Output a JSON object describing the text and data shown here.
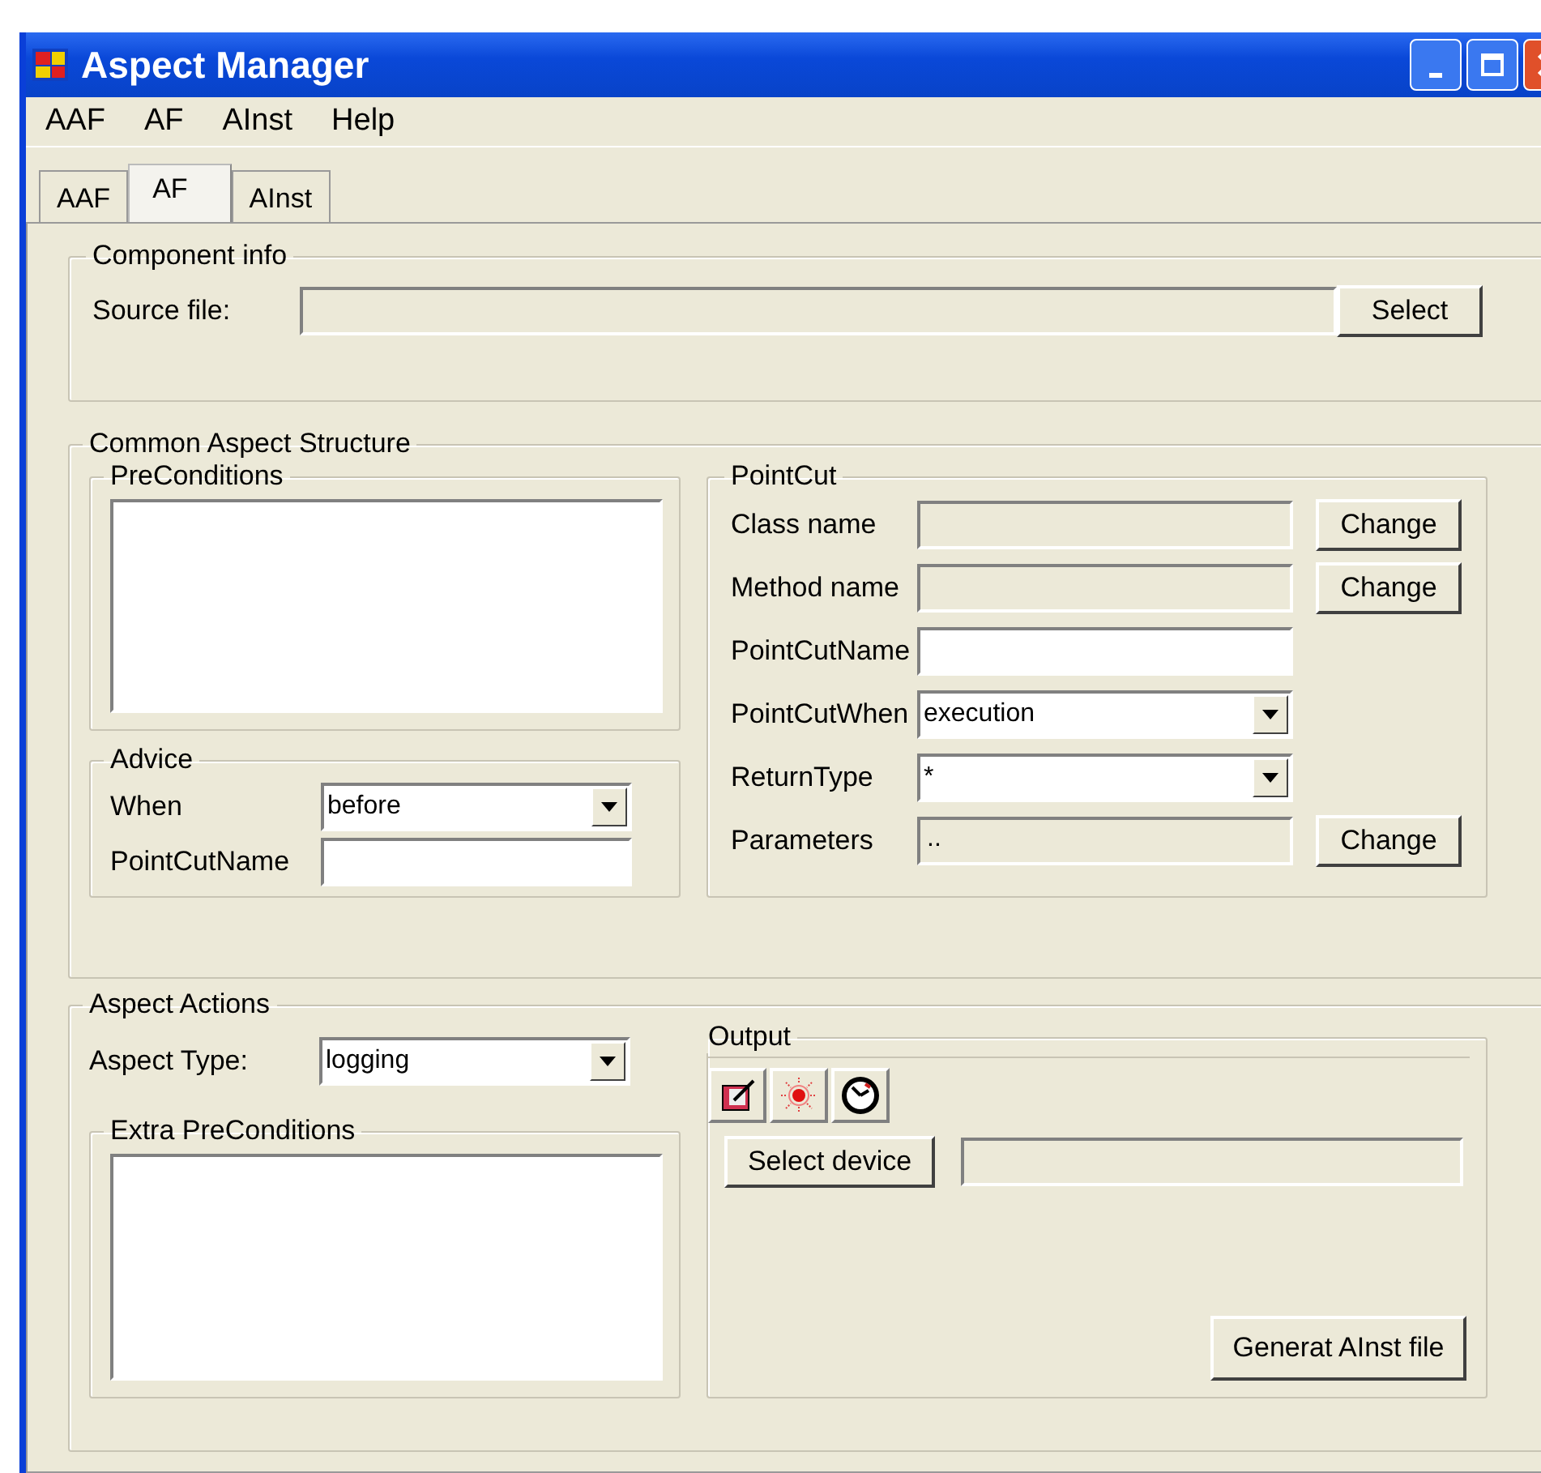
{
  "window": {
    "title": "Aspect Manager"
  },
  "menu": [
    {
      "label": "AAF"
    },
    {
      "label": "AF"
    },
    {
      "label": "AInst"
    },
    {
      "label": "Help"
    }
  ],
  "tabs": [
    {
      "label": "AAF",
      "selected": false
    },
    {
      "label": "AF",
      "selected": true
    },
    {
      "label": "AInst",
      "selected": false
    }
  ],
  "component_info": {
    "title": "Component info",
    "source_label": "Source file:",
    "button": "Select"
  },
  "common_aspect_structure": {
    "title": "Common Aspect Structure",
    "preconditions": {
      "title": "PreConditions"
    },
    "advice": {
      "title": "Advice",
      "fields": [
        {
          "label": "When",
          "kind": "dropdown",
          "value": "before"
        },
        {
          "label": "PointCutName",
          "kind": "text"
        }
      ]
    },
    "pointcut": {
      "title": "PointCut",
      "fields": [
        {
          "label": "Class name",
          "kind": "readonly",
          "button": "Change"
        },
        {
          "label": "Method name",
          "kind": "readonly",
          "button": "Change"
        },
        {
          "label": "PointCutName",
          "kind": "text"
        },
        {
          "label": "PointCutWhen",
          "kind": "dropdown",
          "value": "execution"
        },
        {
          "label": "ReturnType",
          "kind": "dropdown",
          "value": "*"
        },
        {
          "label": "Parameters",
          "kind": "readonly",
          "value": "..",
          "button": "Change"
        }
      ]
    }
  },
  "aspect_actions": {
    "title": "Aspect Actions",
    "aspect_type": {
      "label": "Aspect Type:",
      "value": "logging"
    },
    "extra_preconditions": {
      "title": "Extra PreConditions"
    },
    "output": {
      "title": "Output",
      "select_button": "Select device",
      "generate_button": "Generat AInst file"
    }
  }
}
